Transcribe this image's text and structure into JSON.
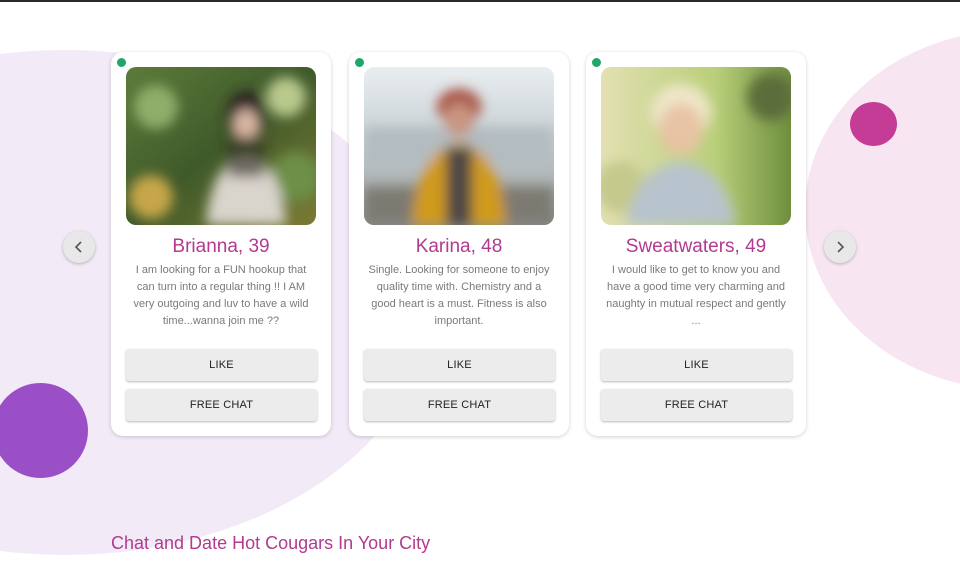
{
  "colors": {
    "accent": "#b23a8f",
    "online": "#1fa66a",
    "dot_purple": "#9a4fc6",
    "dot_pink": "#c43c95"
  },
  "carousel": {
    "prev_icon": "chevron-left-icon",
    "next_icon": "chevron-right-icon"
  },
  "profiles": [
    {
      "name": "Brianna, 39",
      "bio": "I am looking for a FUN hookup that can turn into a regular thing !! I AM very outgoing and luv to have a wild time...wanna join me ??",
      "like_label": "LIKE",
      "chat_label": "FREE CHAT"
    },
    {
      "name": "Karina, 48",
      "bio": "Single. Looking for someone to enjoy quality time with. Chemistry and a good heart is a must. Fitness is also important.",
      "like_label": "LIKE",
      "chat_label": "FREE CHAT"
    },
    {
      "name": "Sweatwaters, 49",
      "bio": "I would like to get to know you and have a good time very charming and naughty in mutual respect and gently ...",
      "like_label": "LIKE",
      "chat_label": "FREE CHAT"
    }
  ],
  "section_heading": "Chat and Date Hot Cougars In Your City"
}
